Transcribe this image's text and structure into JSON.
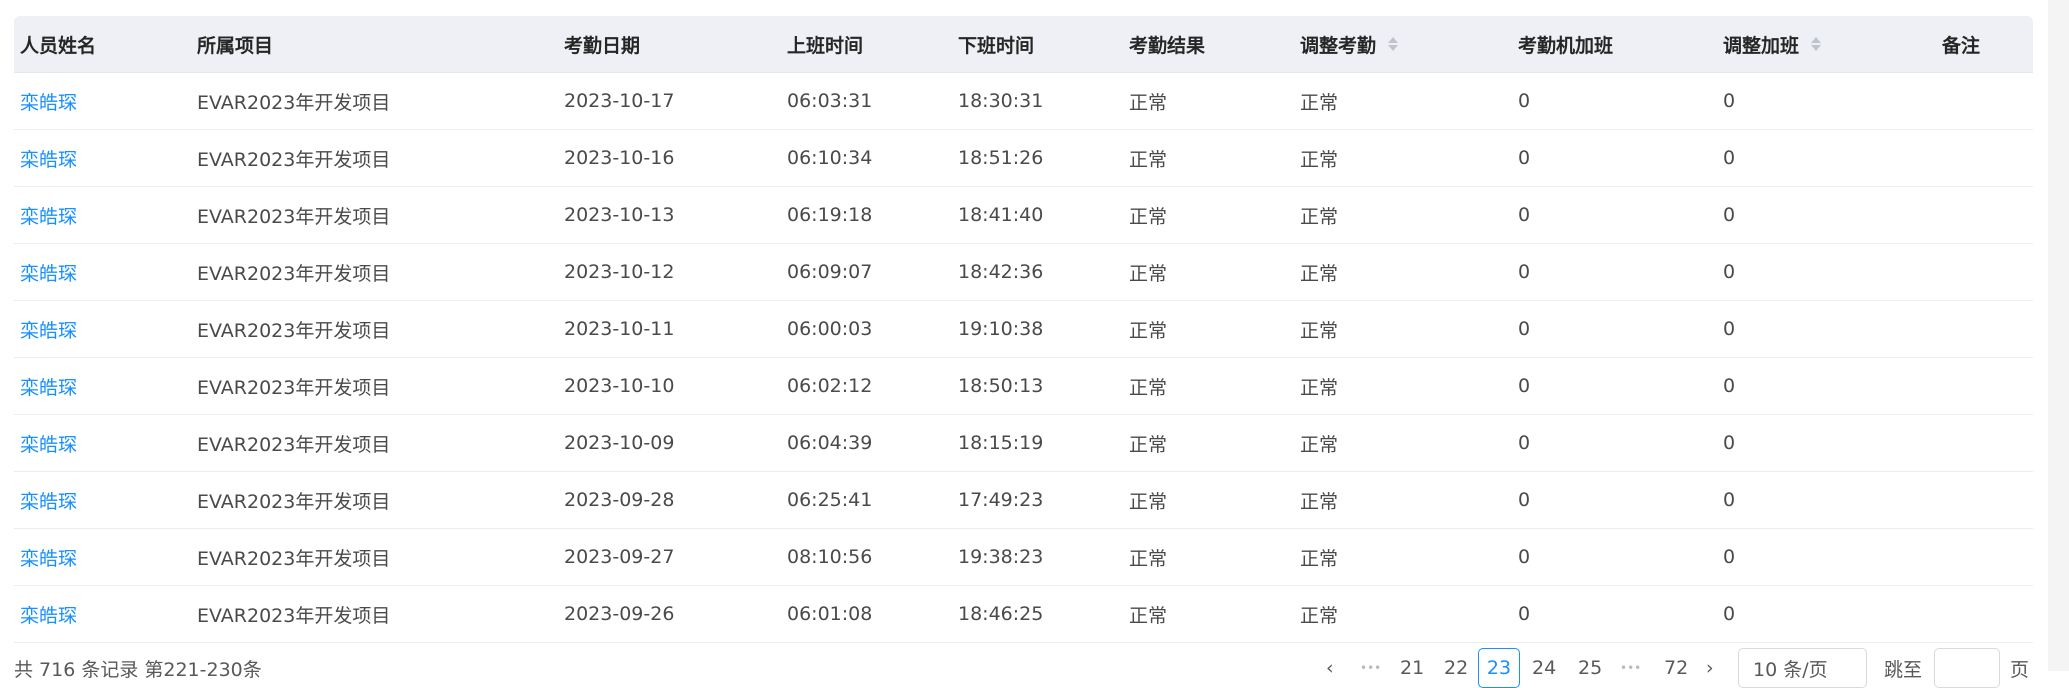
{
  "columns": [
    {
      "label": "人员姓名"
    },
    {
      "label": "所属项目"
    },
    {
      "label": "考勤日期"
    },
    {
      "label": "上班时间"
    },
    {
      "label": "下班时间"
    },
    {
      "label": "考勤结果"
    },
    {
      "label": "调整考勤",
      "sortable": true
    },
    {
      "label": "考勤机加班"
    },
    {
      "label": "调整加班",
      "sortable": true
    },
    {
      "label": "备注"
    }
  ],
  "rows": [
    [
      "栾皓琛",
      "EVAR2023年开发项目",
      "2023-10-17",
      "06:03:31",
      "18:30:31",
      "正常",
      "正常",
      "0",
      "0",
      ""
    ],
    [
      "栾皓琛",
      "EVAR2023年开发项目",
      "2023-10-16",
      "06:10:34",
      "18:51:26",
      "正常",
      "正常",
      "0",
      "0",
      ""
    ],
    [
      "栾皓琛",
      "EVAR2023年开发项目",
      "2023-10-13",
      "06:19:18",
      "18:41:40",
      "正常",
      "正常",
      "0",
      "0",
      ""
    ],
    [
      "栾皓琛",
      "EVAR2023年开发项目",
      "2023-10-12",
      "06:09:07",
      "18:42:36",
      "正常",
      "正常",
      "0",
      "0",
      ""
    ],
    [
      "栾皓琛",
      "EVAR2023年开发项目",
      "2023-10-11",
      "06:00:03",
      "19:10:38",
      "正常",
      "正常",
      "0",
      "0",
      ""
    ],
    [
      "栾皓琛",
      "EVAR2023年开发项目",
      "2023-10-10",
      "06:02:12",
      "18:50:13",
      "正常",
      "正常",
      "0",
      "0",
      ""
    ],
    [
      "栾皓琛",
      "EVAR2023年开发项目",
      "2023-10-09",
      "06:04:39",
      "18:15:19",
      "正常",
      "正常",
      "0",
      "0",
      ""
    ],
    [
      "栾皓琛",
      "EVAR2023年开发项目",
      "2023-09-28",
      "06:25:41",
      "17:49:23",
      "正常",
      "正常",
      "0",
      "0",
      ""
    ],
    [
      "栾皓琛",
      "EVAR2023年开发项目",
      "2023-09-27",
      "08:10:56",
      "19:38:23",
      "正常",
      "正常",
      "0",
      "0",
      ""
    ],
    [
      "栾皓琛",
      "EVAR2023年开发项目",
      "2023-09-26",
      "06:01:08",
      "18:46:25",
      "正常",
      "正常",
      "0",
      "0",
      ""
    ]
  ],
  "pagination": {
    "summary": "共 716 条记录 第221-230条",
    "prev": "‹",
    "ellipsis": "•••",
    "pages": [
      "21",
      "22",
      "23",
      "24",
      "25"
    ],
    "active_page": "23",
    "last_page": "72",
    "next": "›",
    "page_size": "10 条/页",
    "jump_label": "跳至",
    "jump_unit": "页",
    "jump_value": ""
  },
  "colors": {
    "link": "#1890ff",
    "header_bg": "#eff0f5",
    "active": "#1890ff"
  }
}
